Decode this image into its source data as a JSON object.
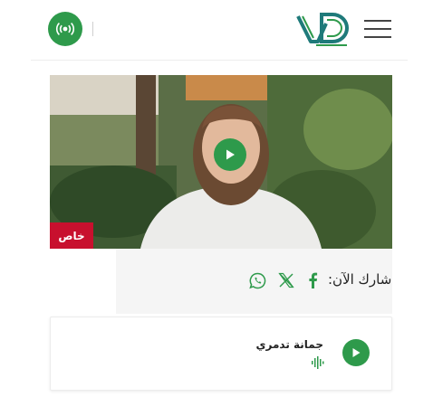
{
  "header": {
    "live_icon": "radio-broadcast-icon",
    "logo_icon": "vd-logo-icon",
    "menu_icon": "hamburger-menu-icon"
  },
  "media": {
    "badge": "خاص",
    "play_icon": "play-icon"
  },
  "share": {
    "label": "شارك الآن:",
    "icons": [
      "facebook-icon",
      "x-twitter-icon",
      "whatsapp-icon"
    ]
  },
  "audio_card": {
    "title": "جمانة تدمري",
    "play_icon": "play-icon",
    "wave_icon": "audio-wave-icon"
  },
  "colors": {
    "accent_green": "#2e9a4b",
    "badge_red": "#c8102e",
    "logo_teal": "#1f7a7a"
  }
}
